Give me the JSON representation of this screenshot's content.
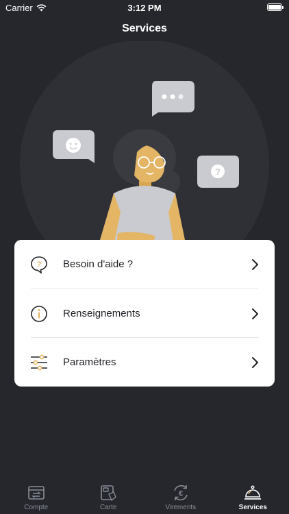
{
  "status_bar": {
    "carrier": "Carrier",
    "time": "3:12 PM"
  },
  "header": {
    "title": "Services"
  },
  "menu": {
    "items": [
      {
        "label": "Besoin d'aide ?",
        "icon": "help-chat-icon"
      },
      {
        "label": "Renseignements",
        "icon": "info-icon"
      },
      {
        "label": "Paramètres",
        "icon": "settings-sliders-icon"
      }
    ]
  },
  "tabs": [
    {
      "label": "Compte",
      "icon": "account-transfer-icon",
      "active": false
    },
    {
      "label": "Carte",
      "icon": "card-icon",
      "active": false
    },
    {
      "label": "Virements",
      "icon": "euro-transfer-icon",
      "active": false
    },
    {
      "label": "Services",
      "icon": "service-bell-icon",
      "active": true
    }
  ],
  "colors": {
    "background": "#25272d",
    "accent": "#e3b565",
    "card": "#ffffff",
    "tab_inactive": "#8a8d96"
  }
}
